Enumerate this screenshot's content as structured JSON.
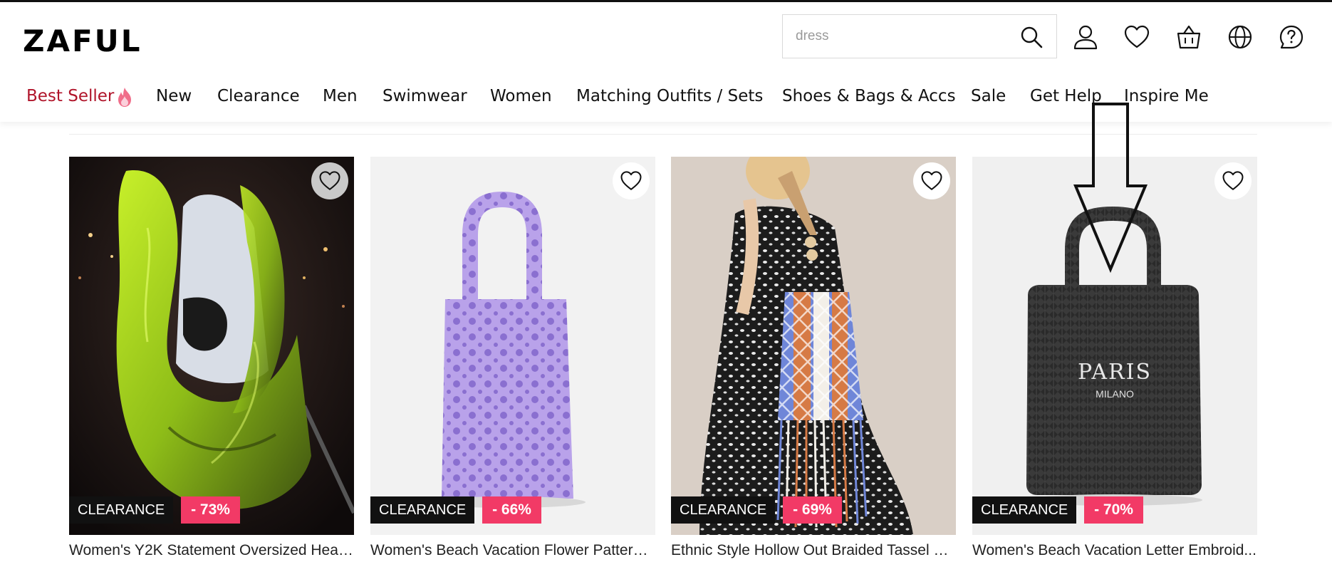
{
  "header": {
    "logo": "ZAFUL",
    "search": {
      "placeholder": "dress"
    },
    "icons": [
      "search-icon",
      "user-icon",
      "heart-icon",
      "cart-icon",
      "globe-icon",
      "help-icon"
    ]
  },
  "nav": {
    "items": [
      {
        "label": "Best Seller"
      },
      {
        "label": "New"
      },
      {
        "label": "Clearance"
      },
      {
        "label": "Men"
      },
      {
        "label": "Swimwear"
      },
      {
        "label": "Women"
      },
      {
        "label": "Matching Outfits / Sets"
      },
      {
        "label": "Shoes & Bags & Accs"
      },
      {
        "label": "Sale"
      },
      {
        "label": "Get Help"
      },
      {
        "label": "Inspire Me"
      }
    ]
  },
  "products": [
    {
      "badge": "CLEARANCE",
      "discount": "- 73%",
      "title": "Women's Y2K Statement Oversized Hear..."
    },
    {
      "badge": "CLEARANCE",
      "discount": "- 66%",
      "title": "Women's Beach Vacation Flower Pattern ..."
    },
    {
      "badge": "CLEARANCE",
      "discount": "- 69%",
      "title": "Ethnic Style Hollow Out Braided Tassel D..."
    },
    {
      "badge": "CLEARANCE",
      "discount": "- 70%",
      "title": "Women's Beach Vacation Letter Embroid...",
      "print_main": "PARIS",
      "print_sub": "MILANO"
    }
  ],
  "colors": {
    "brand_red": "#b0142a",
    "discount_pink": "#f23a66",
    "badge_black": "#111111"
  }
}
